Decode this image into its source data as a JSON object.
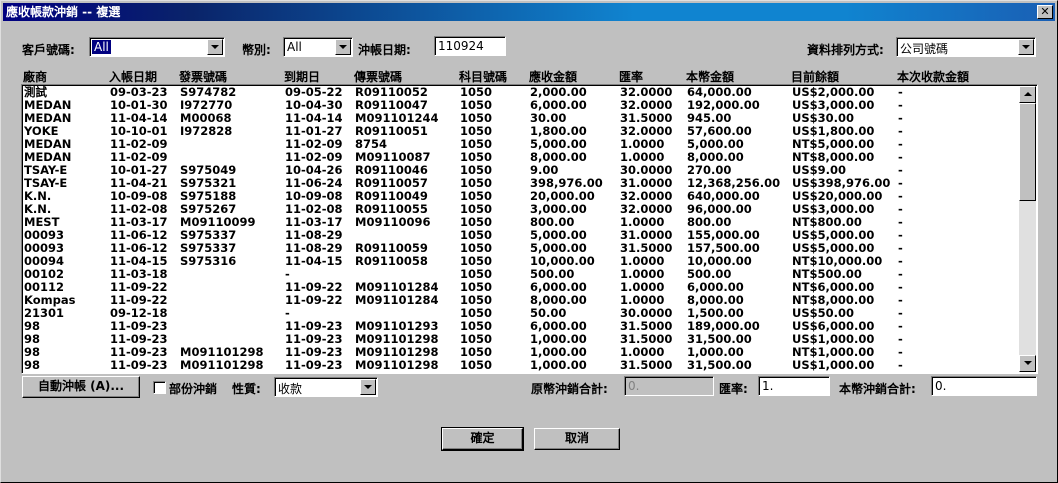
{
  "window": {
    "title": "應收帳款沖銷 -- 複選"
  },
  "filters": {
    "customer_label": "客戶號碼:",
    "customer_value": "All",
    "currency_label": "幣別:",
    "currency_value": "All",
    "date_label": "沖帳日期:",
    "date_value": "110924",
    "sort_label": "資料排列方式:",
    "sort_value": "公司號碼"
  },
  "table": {
    "headers": [
      "廠商",
      "入帳日期",
      "發票號碼",
      "到期日",
      "傳票號碼",
      "科目號碼",
      "應收金額",
      "匯率",
      "本幣金額",
      "目前餘額",
      "本次收款金額"
    ],
    "rows": [
      [
        "測試",
        "09-03-23",
        "S974782",
        "09-05-22",
        "R09110052",
        "1050",
        "2,000.00",
        "32.0000",
        "64,000.00",
        "US$2,000.00",
        "-"
      ],
      [
        "MEDAN",
        "10-01-30",
        "I972770",
        "10-04-30",
        "R09110047",
        "1050",
        "6,000.00",
        "32.0000",
        "192,000.00",
        "US$3,000.00",
        "-"
      ],
      [
        "MEDAN",
        "11-04-14",
        "M00068",
        "11-04-14",
        "M091101244",
        "1050",
        "30.00",
        "31.5000",
        "945.00",
        "US$30.00",
        "-"
      ],
      [
        "YOKE",
        "10-10-01",
        "I972828",
        "11-01-27",
        "R09110051",
        "1050",
        "1,800.00",
        "32.0000",
        "57,600.00",
        "US$1,800.00",
        "-"
      ],
      [
        "MEDAN",
        "11-02-09",
        "",
        "11-02-09",
        "8754",
        "1050",
        "5,000.00",
        "1.0000",
        "5,000.00",
        "NT$5,000.00",
        "-"
      ],
      [
        "MEDAN",
        "11-02-09",
        "",
        "11-02-09",
        "M09110087",
        "1050",
        "8,000.00",
        "1.0000",
        "8,000.00",
        "NT$8,000.00",
        "-"
      ],
      [
        "TSAY-E",
        "10-01-27",
        "S975049",
        "10-04-26",
        "R09110046",
        "1050",
        "9.00",
        "30.0000",
        "270.00",
        "US$9.00",
        "-"
      ],
      [
        "TSAY-E",
        "11-04-21",
        "S975321",
        "11-06-24",
        "R09110057",
        "1050",
        "398,976.00",
        "31.0000",
        "12,368,256.00",
        "US$398,976.00",
        "-"
      ],
      [
        "K.N.",
        "10-09-08",
        "S975188",
        "10-09-08",
        "R09110049",
        "1050",
        "20,000.00",
        "32.0000",
        "640,000.00",
        "US$20,000.00",
        "-"
      ],
      [
        "K.N.",
        "11-02-08",
        "S975267",
        "11-02-08",
        "R09110055",
        "1050",
        "3,000.00",
        "32.0000",
        "96,000.00",
        "US$3,000.00",
        "-"
      ],
      [
        "MEST",
        "11-03-17",
        "M09110099",
        "11-03-17",
        "M09110096",
        "1050",
        "800.00",
        "1.0000",
        "800.00",
        "NT$800.00",
        "-"
      ],
      [
        "00093",
        "11-06-12",
        "S975337",
        "11-08-29",
        "",
        "1050",
        "5,000.00",
        "31.0000",
        "155,000.00",
        "US$5,000.00",
        "-"
      ],
      [
        "00093",
        "11-06-12",
        "S975337",
        "11-08-29",
        "R09110059",
        "1050",
        "5,000.00",
        "31.5000",
        "157,500.00",
        "US$5,000.00",
        "-"
      ],
      [
        "00094",
        "11-04-15",
        "S975316",
        "11-04-15",
        "R09110058",
        "1050",
        "10,000.00",
        "1.0000",
        "10,000.00",
        "NT$10,000.00",
        "-"
      ],
      [
        "00102",
        "11-03-18",
        "",
        "-",
        "",
        "1050",
        "500.00",
        "1.0000",
        "500.00",
        "NT$500.00",
        "-"
      ],
      [
        "00112",
        "11-09-22",
        "",
        "11-09-22",
        "M091101284",
        "1050",
        "6,000.00",
        "1.0000",
        "6,000.00",
        "NT$6,000.00",
        "-"
      ],
      [
        "Kompas",
        "11-09-22",
        "",
        "11-09-22",
        "M091101284",
        "1050",
        "8,000.00",
        "1.0000",
        "8,000.00",
        "NT$8,000.00",
        "-"
      ],
      [
        "21301",
        "09-12-18",
        "",
        "-",
        "",
        "1050",
        "50.00",
        "30.0000",
        "1,500.00",
        "US$50.00",
        "-"
      ],
      [
        "98",
        "11-09-23",
        "",
        "11-09-23",
        "M091101293",
        "1050",
        "6,000.00",
        "31.5000",
        "189,000.00",
        "US$6,000.00",
        "-"
      ],
      [
        "98",
        "11-09-23",
        "",
        "11-09-23",
        "M091101298",
        "1050",
        "1,000.00",
        "31.5000",
        "31,500.00",
        "US$1,000.00",
        "-"
      ],
      [
        "98",
        "11-09-23",
        "M091101298",
        "11-09-23",
        "M091101298",
        "1050",
        "1,000.00",
        "1.0000",
        "1,000.00",
        "NT$1,000.00",
        "-"
      ],
      [
        "98",
        "11-09-23",
        "M091101298",
        "11-09-23",
        "M091101298",
        "1050",
        "1,000.00",
        "31.5000",
        "31,500.00",
        "US$1,000.00",
        "-"
      ]
    ]
  },
  "bottom": {
    "auto_button": "自動沖帳 (A)...",
    "partial_label": "部份沖銷",
    "nature_label": "性質:",
    "nature_value": "收款",
    "orig_total_label": "原幣沖銷合計:",
    "orig_total_value": "0.",
    "rate_label": "匯率:",
    "rate_value": "1.",
    "local_total_label": "本幣沖銷合計:",
    "local_total_value": "0."
  },
  "actions": {
    "ok": "確定",
    "cancel": "取消"
  }
}
